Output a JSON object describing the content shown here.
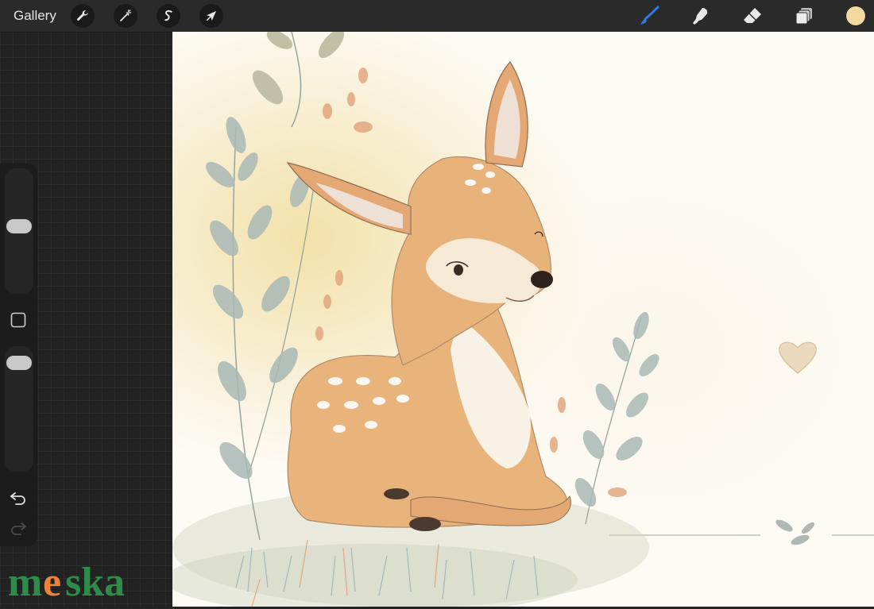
{
  "toolbar": {
    "gallery_label": "Gallery",
    "left_tools": [
      {
        "name": "actions",
        "icon": "wrench-icon"
      },
      {
        "name": "adjustments",
        "icon": "magic-wand-icon"
      },
      {
        "name": "selection",
        "icon": "selection-s-icon"
      },
      {
        "name": "transform",
        "icon": "arrow-cursor-icon"
      }
    ],
    "right_tools": [
      {
        "name": "brush",
        "icon": "brush-icon",
        "active": true
      },
      {
        "name": "smudge",
        "icon": "smudge-finger-icon"
      },
      {
        "name": "eraser",
        "icon": "eraser-icon"
      },
      {
        "name": "layers",
        "icon": "layers-icon"
      }
    ],
    "current_color": "#f2d9a0",
    "active_accent": "#2b7de9"
  },
  "sidebar": {
    "brush_size_level": 0.55,
    "opacity_level": 0.05,
    "modify_icon": "square-icon",
    "undo_icon": "undo-arrow-icon",
    "redo_icon": "redo-arrow-icon"
  },
  "canvas": {
    "subject": "illustration"
  },
  "watermark": {
    "text": "meska",
    "color": "#2e8b4a",
    "accent": "#e8843a"
  }
}
